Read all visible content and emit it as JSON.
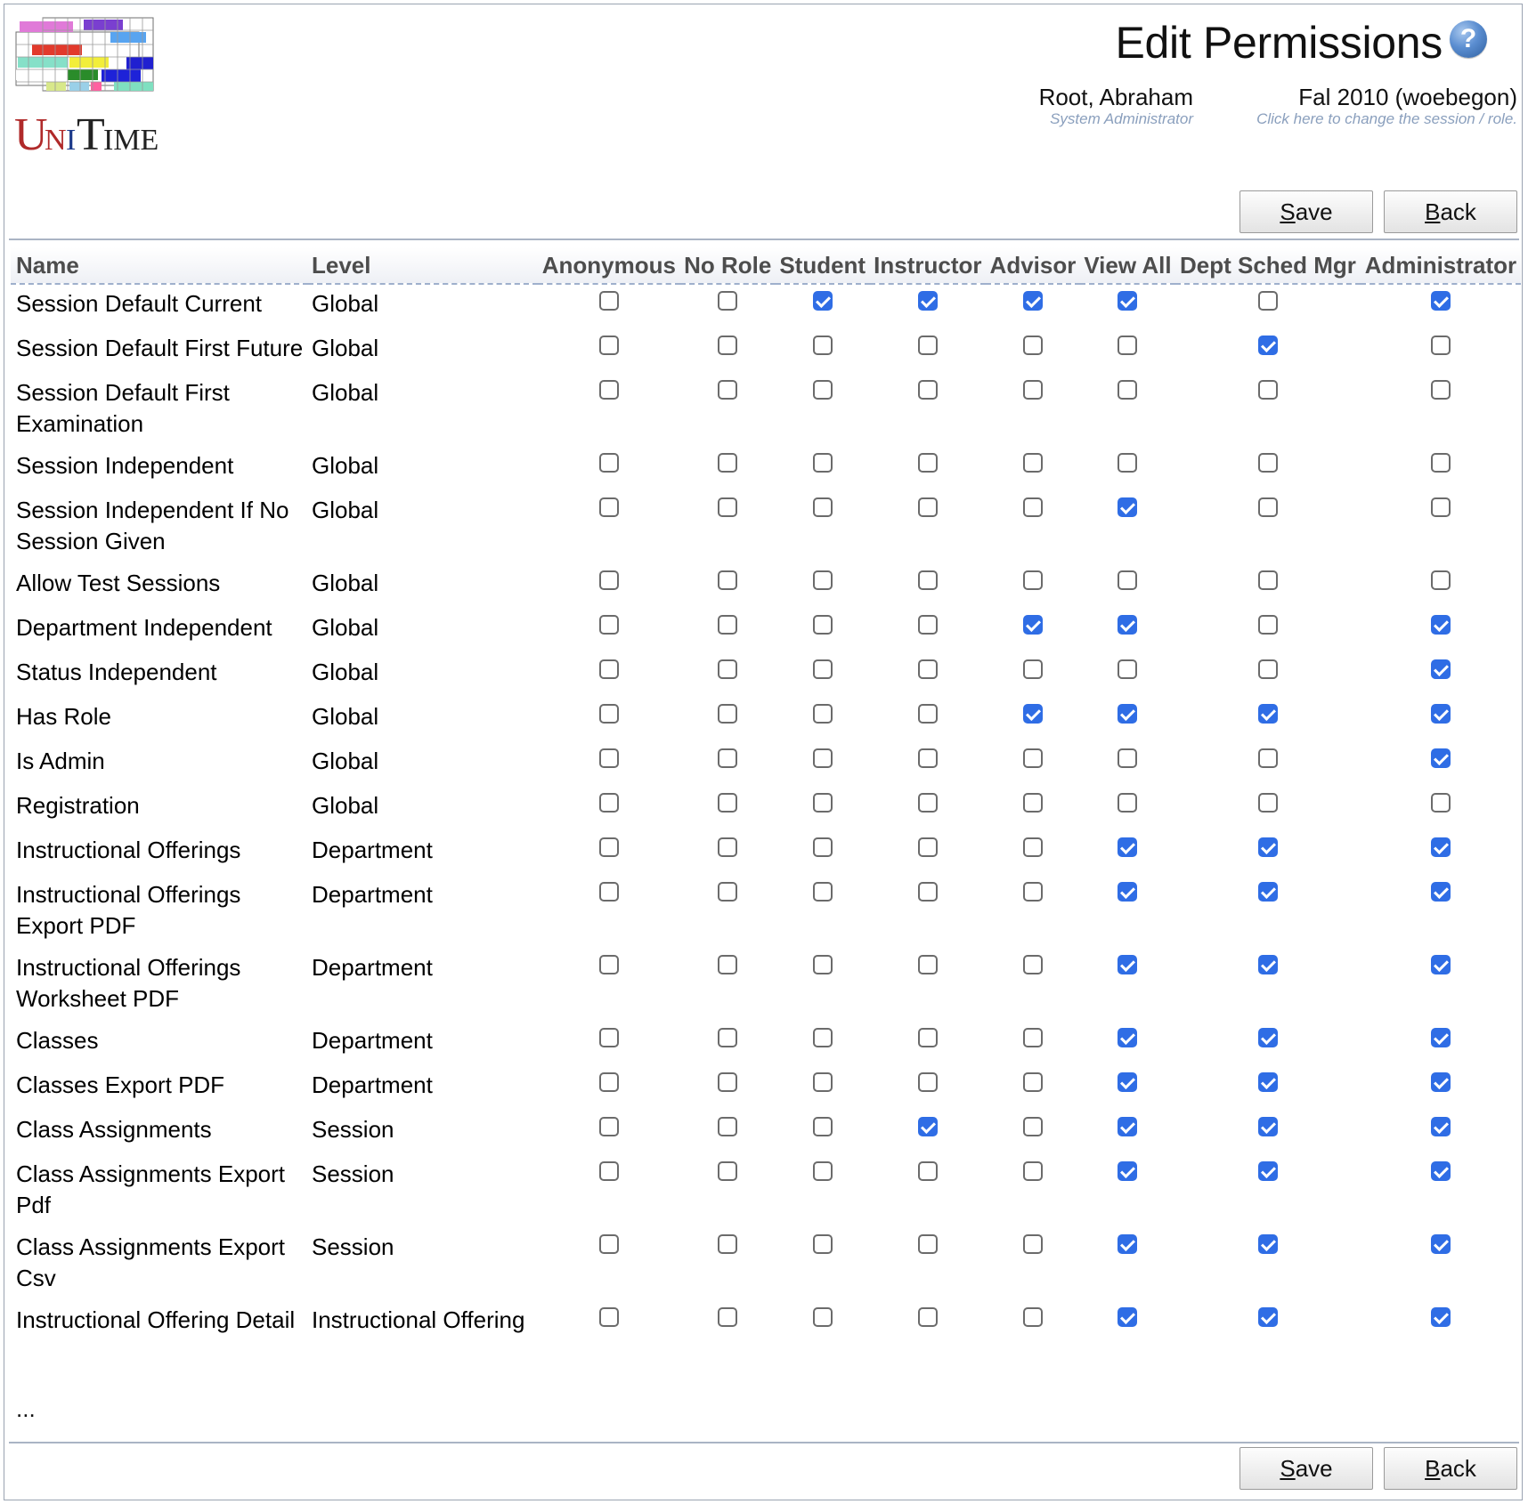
{
  "header": {
    "title": "Edit Permissions",
    "logo_text": "UniTime",
    "user": {
      "name": "Root, Abraham",
      "role": "System Administrator"
    },
    "session": {
      "name": "Fal 2010 (woebegon)",
      "hint": "Click here to change the session / role."
    }
  },
  "buttons": {
    "save": {
      "accel": "S",
      "rest": "ave"
    },
    "back": {
      "accel": "B",
      "rest": "ack"
    }
  },
  "table": {
    "headers": {
      "name": "Name",
      "level": "Level",
      "roles": [
        "Anonymous",
        "No Role",
        "Student",
        "Instructor",
        "Advisor",
        "View All",
        "Dept Sched Mgr",
        "Administrator"
      ]
    },
    "rows": [
      {
        "name": "Session Default Current",
        "level": "Global",
        "perms": [
          false,
          false,
          true,
          true,
          true,
          true,
          false,
          true
        ]
      },
      {
        "name": "Session Default First Future",
        "level": "Global",
        "perms": [
          false,
          false,
          false,
          false,
          false,
          false,
          true,
          false
        ]
      },
      {
        "name": "Session Default First Examination",
        "level": "Global",
        "perms": [
          false,
          false,
          false,
          false,
          false,
          false,
          false,
          false
        ]
      },
      {
        "name": "Session Independent",
        "level": "Global",
        "perms": [
          false,
          false,
          false,
          false,
          false,
          false,
          false,
          false
        ]
      },
      {
        "name": "Session Independent If No Session Given",
        "level": "Global",
        "perms": [
          false,
          false,
          false,
          false,
          false,
          true,
          false,
          false
        ]
      },
      {
        "name": "Allow Test Sessions",
        "level": "Global",
        "perms": [
          false,
          false,
          false,
          false,
          false,
          false,
          false,
          false
        ]
      },
      {
        "name": "Department Independent",
        "level": "Global",
        "perms": [
          false,
          false,
          false,
          false,
          true,
          true,
          false,
          true
        ]
      },
      {
        "name": "Status Independent",
        "level": "Global",
        "perms": [
          false,
          false,
          false,
          false,
          false,
          false,
          false,
          true
        ]
      },
      {
        "name": "Has Role",
        "level": "Global",
        "perms": [
          false,
          false,
          false,
          false,
          true,
          true,
          true,
          true
        ]
      },
      {
        "name": "Is Admin",
        "level": "Global",
        "perms": [
          false,
          false,
          false,
          false,
          false,
          false,
          false,
          true
        ]
      },
      {
        "name": "Registration",
        "level": "Global",
        "perms": [
          false,
          false,
          false,
          false,
          false,
          false,
          false,
          false
        ]
      },
      {
        "name": "Instructional Offerings",
        "level": "Department",
        "perms": [
          false,
          false,
          false,
          false,
          false,
          true,
          true,
          true
        ]
      },
      {
        "name": "Instructional Offerings Export PDF",
        "level": "Department",
        "perms": [
          false,
          false,
          false,
          false,
          false,
          true,
          true,
          true
        ]
      },
      {
        "name": "Instructional Offerings Worksheet PDF",
        "level": "Department",
        "perms": [
          false,
          false,
          false,
          false,
          false,
          true,
          true,
          true
        ]
      },
      {
        "name": "Classes",
        "level": "Department",
        "perms": [
          false,
          false,
          false,
          false,
          false,
          true,
          true,
          true
        ]
      },
      {
        "name": "Classes Export PDF",
        "level": "Department",
        "perms": [
          false,
          false,
          false,
          false,
          false,
          true,
          true,
          true
        ]
      },
      {
        "name": "Class Assignments",
        "level": "Session",
        "perms": [
          false,
          false,
          false,
          true,
          false,
          true,
          true,
          true
        ]
      },
      {
        "name": "Class Assignments Export Pdf",
        "level": "Session",
        "perms": [
          false,
          false,
          false,
          false,
          false,
          true,
          true,
          true
        ]
      },
      {
        "name": "Class Assignments Export Csv",
        "level": "Session",
        "perms": [
          false,
          false,
          false,
          false,
          false,
          true,
          true,
          true
        ]
      },
      {
        "name": "Instructional Offering Detail",
        "level": "Instructional Offering",
        "perms": [
          false,
          false,
          false,
          false,
          false,
          true,
          true,
          true
        ]
      }
    ],
    "more": "..."
  }
}
